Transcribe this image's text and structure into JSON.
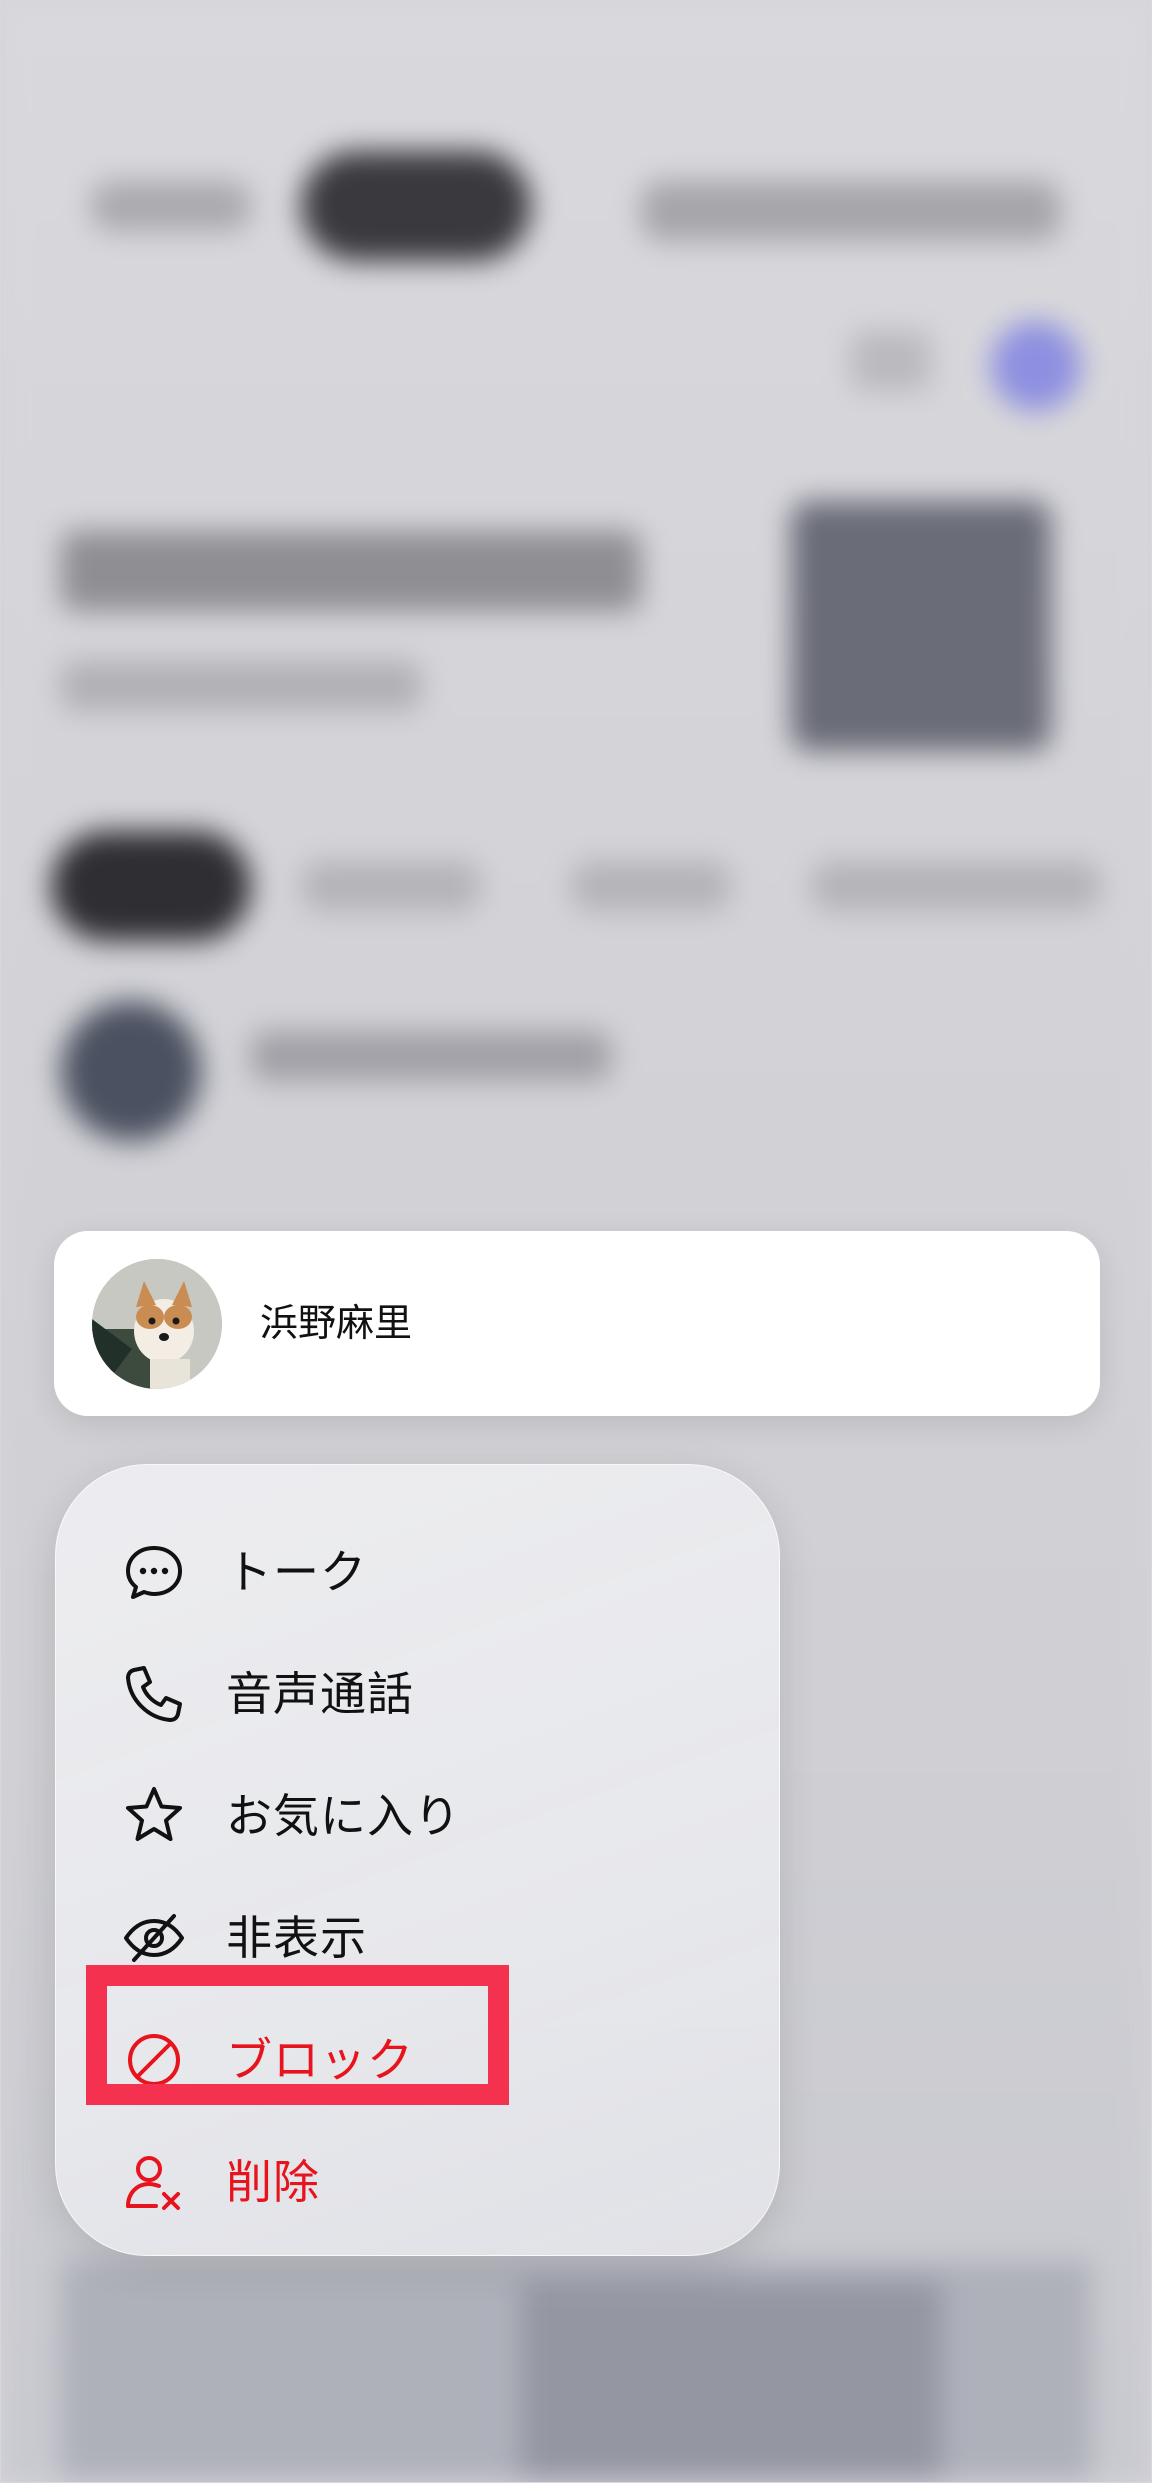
{
  "contact": {
    "name": "浜野麻里"
  },
  "menu": {
    "items": [
      {
        "label": "トーク",
        "icon": "chat-bubble-icon"
      },
      {
        "label": "音声通話",
        "icon": "phone-icon"
      },
      {
        "label": "お気に入り",
        "icon": "star-icon"
      },
      {
        "label": "非表示",
        "icon": "eye-slash-icon"
      },
      {
        "label": "ブロック",
        "icon": "block-icon"
      },
      {
        "label": "削除",
        "icon": "delete-user-icon"
      }
    ]
  },
  "colors": {
    "danger": "#e8141d",
    "highlight": "#f4324f"
  }
}
